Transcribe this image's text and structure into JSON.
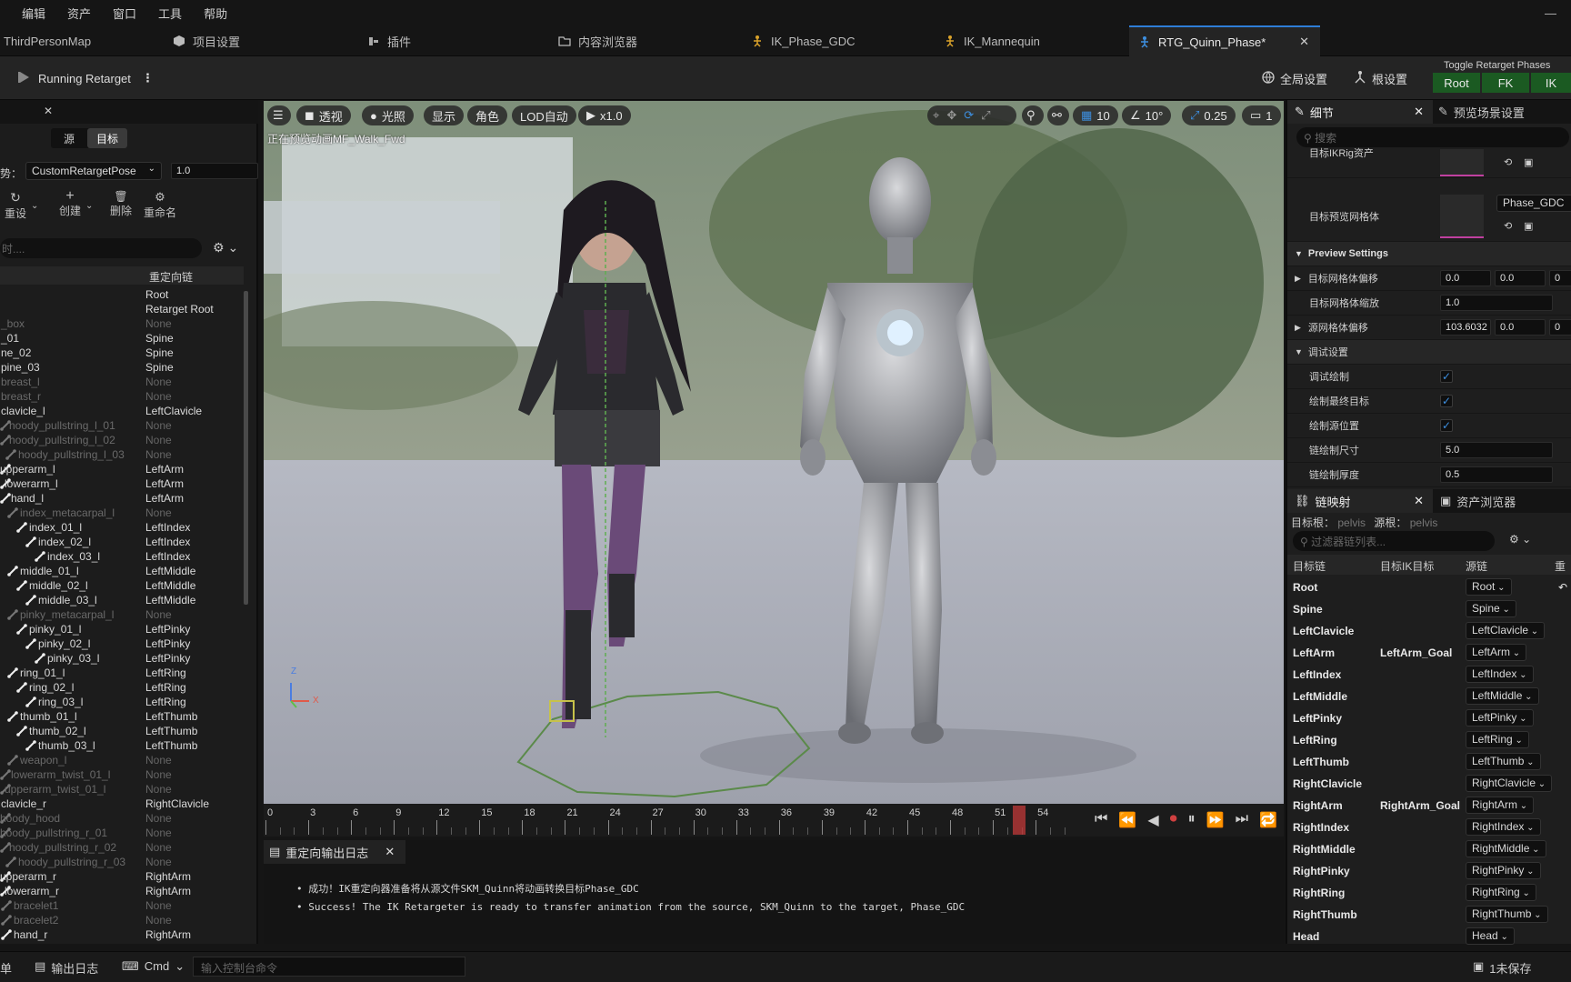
{
  "menu": [
    "编辑",
    "资产",
    "窗口",
    "工具",
    "帮助"
  ],
  "tabs": {
    "map": "ThirdPersonMap",
    "project_settings": "项目设置",
    "plugins": "插件",
    "content_browser": "内容浏览器",
    "ik_phase": "IK_Phase_GDC",
    "ik_mannequin": "IK_Mannequin",
    "rtg": "RTG_Quinn_Phase*"
  },
  "toolbar": {
    "running": "Running Retarget",
    "global_settings": "全局设置",
    "root_settings": "根设置",
    "toggle_label": "Toggle Retarget Phases",
    "phases": [
      "Root",
      "FK",
      "IK"
    ]
  },
  "left": {
    "tab_source": "源",
    "tab_target": "目标",
    "pose_label": "势：",
    "pose_value": "CustomRetargetPose",
    "pose_amount": "1.0",
    "actions": [
      "重设",
      "创建",
      "删除",
      "重命名"
    ],
    "search_placeholder": "时....",
    "col_chain": "重定向链",
    "rows": [
      {
        "bone": "",
        "chain": "Root",
        "d": 1,
        "dim": false,
        "icon": false
      },
      {
        "bone": "",
        "chain": "Retarget Root",
        "d": 1,
        "dim": false,
        "icon": false
      },
      {
        "bone": "_box",
        "chain": "None",
        "d": 1,
        "dim": true,
        "icon": false
      },
      {
        "bone": "_01",
        "chain": "Spine",
        "d": 1,
        "dim": false,
        "icon": false
      },
      {
        "bone": "ne_02",
        "chain": "Spine",
        "d": 1,
        "dim": false,
        "icon": false
      },
      {
        "bone": "pine_03",
        "chain": "Spine",
        "d": 1,
        "dim": false,
        "icon": false
      },
      {
        "bone": "breast_l",
        "chain": "None",
        "d": 1,
        "dim": true,
        "icon": false
      },
      {
        "bone": "breast_r",
        "chain": "None",
        "d": 1,
        "dim": true,
        "icon": false
      },
      {
        "bone": "clavicle_l",
        "chain": "LeftClavicle",
        "d": 1,
        "dim": false,
        "icon": false
      },
      {
        "bone": "hoody_pullstring_l_01",
        "chain": "None",
        "d": 10,
        "dim": true,
        "icon": true
      },
      {
        "bone": "hoody_pullstring_l_02",
        "chain": "None",
        "d": 10,
        "dim": true,
        "icon": true
      },
      {
        "bone": "hoody_pullstring_l_03",
        "chain": "None",
        "d": 20,
        "dim": true,
        "icon": true
      },
      {
        "bone": "upperarm_l",
        "chain": "LeftArm",
        "d": 0,
        "dim": false,
        "icon": true
      },
      {
        "bone": "lowerarm_l",
        "chain": "LeftArm",
        "d": 5,
        "dim": false,
        "icon": true
      },
      {
        "bone": "hand_l",
        "chain": "LeftArm",
        "d": 12,
        "dim": false,
        "icon": true
      },
      {
        "bone": "index_metacarpal_l",
        "chain": "None",
        "d": 22,
        "dim": true,
        "icon": true
      },
      {
        "bone": "index_01_l",
        "chain": "LeftIndex",
        "d": 32,
        "dim": false,
        "icon": true
      },
      {
        "bone": "index_02_l",
        "chain": "LeftIndex",
        "d": 42,
        "dim": false,
        "icon": true
      },
      {
        "bone": "index_03_l",
        "chain": "LeftIndex",
        "d": 52,
        "dim": false,
        "icon": true
      },
      {
        "bone": "middle_01_l",
        "chain": "LeftMiddle",
        "d": 22,
        "dim": false,
        "icon": true
      },
      {
        "bone": "middle_02_l",
        "chain": "LeftMiddle",
        "d": 32,
        "dim": false,
        "icon": true
      },
      {
        "bone": "middle_03_l",
        "chain": "LeftMiddle",
        "d": 42,
        "dim": false,
        "icon": true
      },
      {
        "bone": "pinky_metacarpal_l",
        "chain": "None",
        "d": 22,
        "dim": true,
        "icon": true
      },
      {
        "bone": "pinky_01_l",
        "chain": "LeftPinky",
        "d": 32,
        "dim": false,
        "icon": true
      },
      {
        "bone": "pinky_02_l",
        "chain": "LeftPinky",
        "d": 42,
        "dim": false,
        "icon": true
      },
      {
        "bone": "pinky_03_l",
        "chain": "LeftPinky",
        "d": 52,
        "dim": false,
        "icon": true
      },
      {
        "bone": "ring_01_l",
        "chain": "LeftRing",
        "d": 22,
        "dim": false,
        "icon": true
      },
      {
        "bone": "ring_02_l",
        "chain": "LeftRing",
        "d": 32,
        "dim": false,
        "icon": true
      },
      {
        "bone": "ring_03_l",
        "chain": "LeftRing",
        "d": 42,
        "dim": false,
        "icon": true
      },
      {
        "bone": "thumb_01_l",
        "chain": "LeftThumb",
        "d": 22,
        "dim": false,
        "icon": true
      },
      {
        "bone": "thumb_02_l",
        "chain": "LeftThumb",
        "d": 32,
        "dim": false,
        "icon": true
      },
      {
        "bone": "thumb_03_l",
        "chain": "LeftThumb",
        "d": 42,
        "dim": false,
        "icon": true
      },
      {
        "bone": "weapon_l",
        "chain": "None",
        "d": 22,
        "dim": true,
        "icon": true
      },
      {
        "bone": "lowerarm_twist_01_l",
        "chain": "None",
        "d": 12,
        "dim": true,
        "icon": true
      },
      {
        "bone": "upperarm_twist_01_l",
        "chain": "None",
        "d": 5,
        "dim": true,
        "icon": true
      },
      {
        "bone": "clavicle_r",
        "chain": "RightClavicle",
        "d": 1,
        "dim": false,
        "icon": false
      },
      {
        "bone": "hoody_hood",
        "chain": "None",
        "d": 0,
        "dim": true,
        "icon": true
      },
      {
        "bone": "hoody_pullstring_r_01",
        "chain": "None",
        "d": 0,
        "dim": true,
        "icon": true
      },
      {
        "bone": "hoody_pullstring_r_02",
        "chain": "None",
        "d": 10,
        "dim": true,
        "icon": true
      },
      {
        "bone": "hoody_pullstring_r_03",
        "chain": "None",
        "d": 20,
        "dim": true,
        "icon": true
      },
      {
        "bone": "upperarm_r",
        "chain": "RightArm",
        "d": 0,
        "dim": false,
        "icon": true
      },
      {
        "bone": "lowerarm_r",
        "chain": "RightArm",
        "d": 5,
        "dim": false,
        "icon": true
      },
      {
        "bone": "bracelet1",
        "chain": "None",
        "d": 15,
        "dim": true,
        "icon": true
      },
      {
        "bone": "bracelet2",
        "chain": "None",
        "d": 15,
        "dim": true,
        "icon": true
      },
      {
        "bone": "hand_r",
        "chain": "RightArm",
        "d": 15,
        "dim": false,
        "icon": true
      }
    ]
  },
  "viewport": {
    "buttons": [
      "透视",
      "光照",
      "显示",
      "角色",
      "LOD自动",
      "x1.0"
    ],
    "grid": "10",
    "angle": "10°",
    "scale": "0.25",
    "cam": "1",
    "preview_text": "正在预览动画MF_Walk_Fwd",
    "axis_z": "Z",
    "axis_x": "X"
  },
  "timeline": {
    "ticks": [
      "0",
      "3",
      "6",
      "9",
      "12",
      "15",
      "18",
      "21",
      "24",
      "27",
      "30",
      "33",
      "36",
      "39",
      "42",
      "45",
      "48",
      "51",
      "54"
    ],
    "current_frame": 51
  },
  "log": {
    "tab": "重定向输出日志",
    "lines": [
      "成功！IK重定向器准备将从源文件SKM_Quinn将动画转换目标Phase_GDC",
      "Success! The IK Retargeter is ready to transfer animation from the source, SKM_Quinn to the target, Phase_GDC"
    ]
  },
  "details": {
    "tab": "细节",
    "tab2": "预览场景设置",
    "search_placeholder": "搜索",
    "target_ik_rig": "目标IKRig资产",
    "target_preview_mesh": "目标预览网格体",
    "mesh_name": "Phase_GDC",
    "preview_settings": "Preview Settings",
    "offset_label": "目标网格体偏移",
    "offset_x": "0.0",
    "offset_y": "0.0",
    "offset_z": "0",
    "scale_label": "目标网格体缩放",
    "scale_value": "1.0",
    "src_offset_label": "源网格体偏移",
    "src_offset_x": "103.6032",
    "src_offset_y": "0.0",
    "src_offset_z": "0",
    "debug_section": "调试设置",
    "debug_draw": "调试绘制",
    "draw_final_goal": "绘制最终目标",
    "draw_source_location": "绘制源位置",
    "chain_size_label": "链绘制尺寸",
    "chain_size": "5.0",
    "chain_thickness_label": "链绘制厚度",
    "chain_thickness": "0.5"
  },
  "chainmap": {
    "tab": "链映射",
    "tab2": "资产浏览器",
    "target_root_label": "目标根：",
    "target_root": "pelvis",
    "source_root_label": "源根：",
    "source_root": "pelvis",
    "filter_placeholder": "过滤器链列表...",
    "cols": [
      "目标链",
      "目标IK目标",
      "源链",
      "重"
    ],
    "rows": [
      {
        "target": "Root",
        "goal": "",
        "source": "Root"
      },
      {
        "target": "Spine",
        "goal": "",
        "source": "Spine"
      },
      {
        "target": "LeftClavicle",
        "goal": "",
        "source": "LeftClavicle"
      },
      {
        "target": "LeftArm",
        "goal": "LeftArm_Goal",
        "source": "LeftArm"
      },
      {
        "target": "LeftIndex",
        "goal": "",
        "source": "LeftIndex"
      },
      {
        "target": "LeftMiddle",
        "goal": "",
        "source": "LeftMiddle"
      },
      {
        "target": "LeftPinky",
        "goal": "",
        "source": "LeftPinky"
      },
      {
        "target": "LeftRing",
        "goal": "",
        "source": "LeftRing"
      },
      {
        "target": "LeftThumb",
        "goal": "",
        "source": "LeftThumb"
      },
      {
        "target": "RightClavicle",
        "goal": "",
        "source": "RightClavicle"
      },
      {
        "target": "RightArm",
        "goal": "RightArm_Goal",
        "source": "RightArm"
      },
      {
        "target": "RightIndex",
        "goal": "",
        "source": "RightIndex"
      },
      {
        "target": "RightMiddle",
        "goal": "",
        "source": "RightMiddle"
      },
      {
        "target": "RightPinky",
        "goal": "",
        "source": "RightPinky"
      },
      {
        "target": "RightRing",
        "goal": "",
        "source": "RightRing"
      },
      {
        "target": "RightThumb",
        "goal": "",
        "source": "RightThumb"
      },
      {
        "target": "Head",
        "goal": "",
        "source": "Head"
      }
    ]
  },
  "status": {
    "left": "单",
    "output_log": "输出日志",
    "cmd": "Cmd",
    "console_placeholder": "输入控制台命令",
    "unsaved": "1未保存"
  }
}
